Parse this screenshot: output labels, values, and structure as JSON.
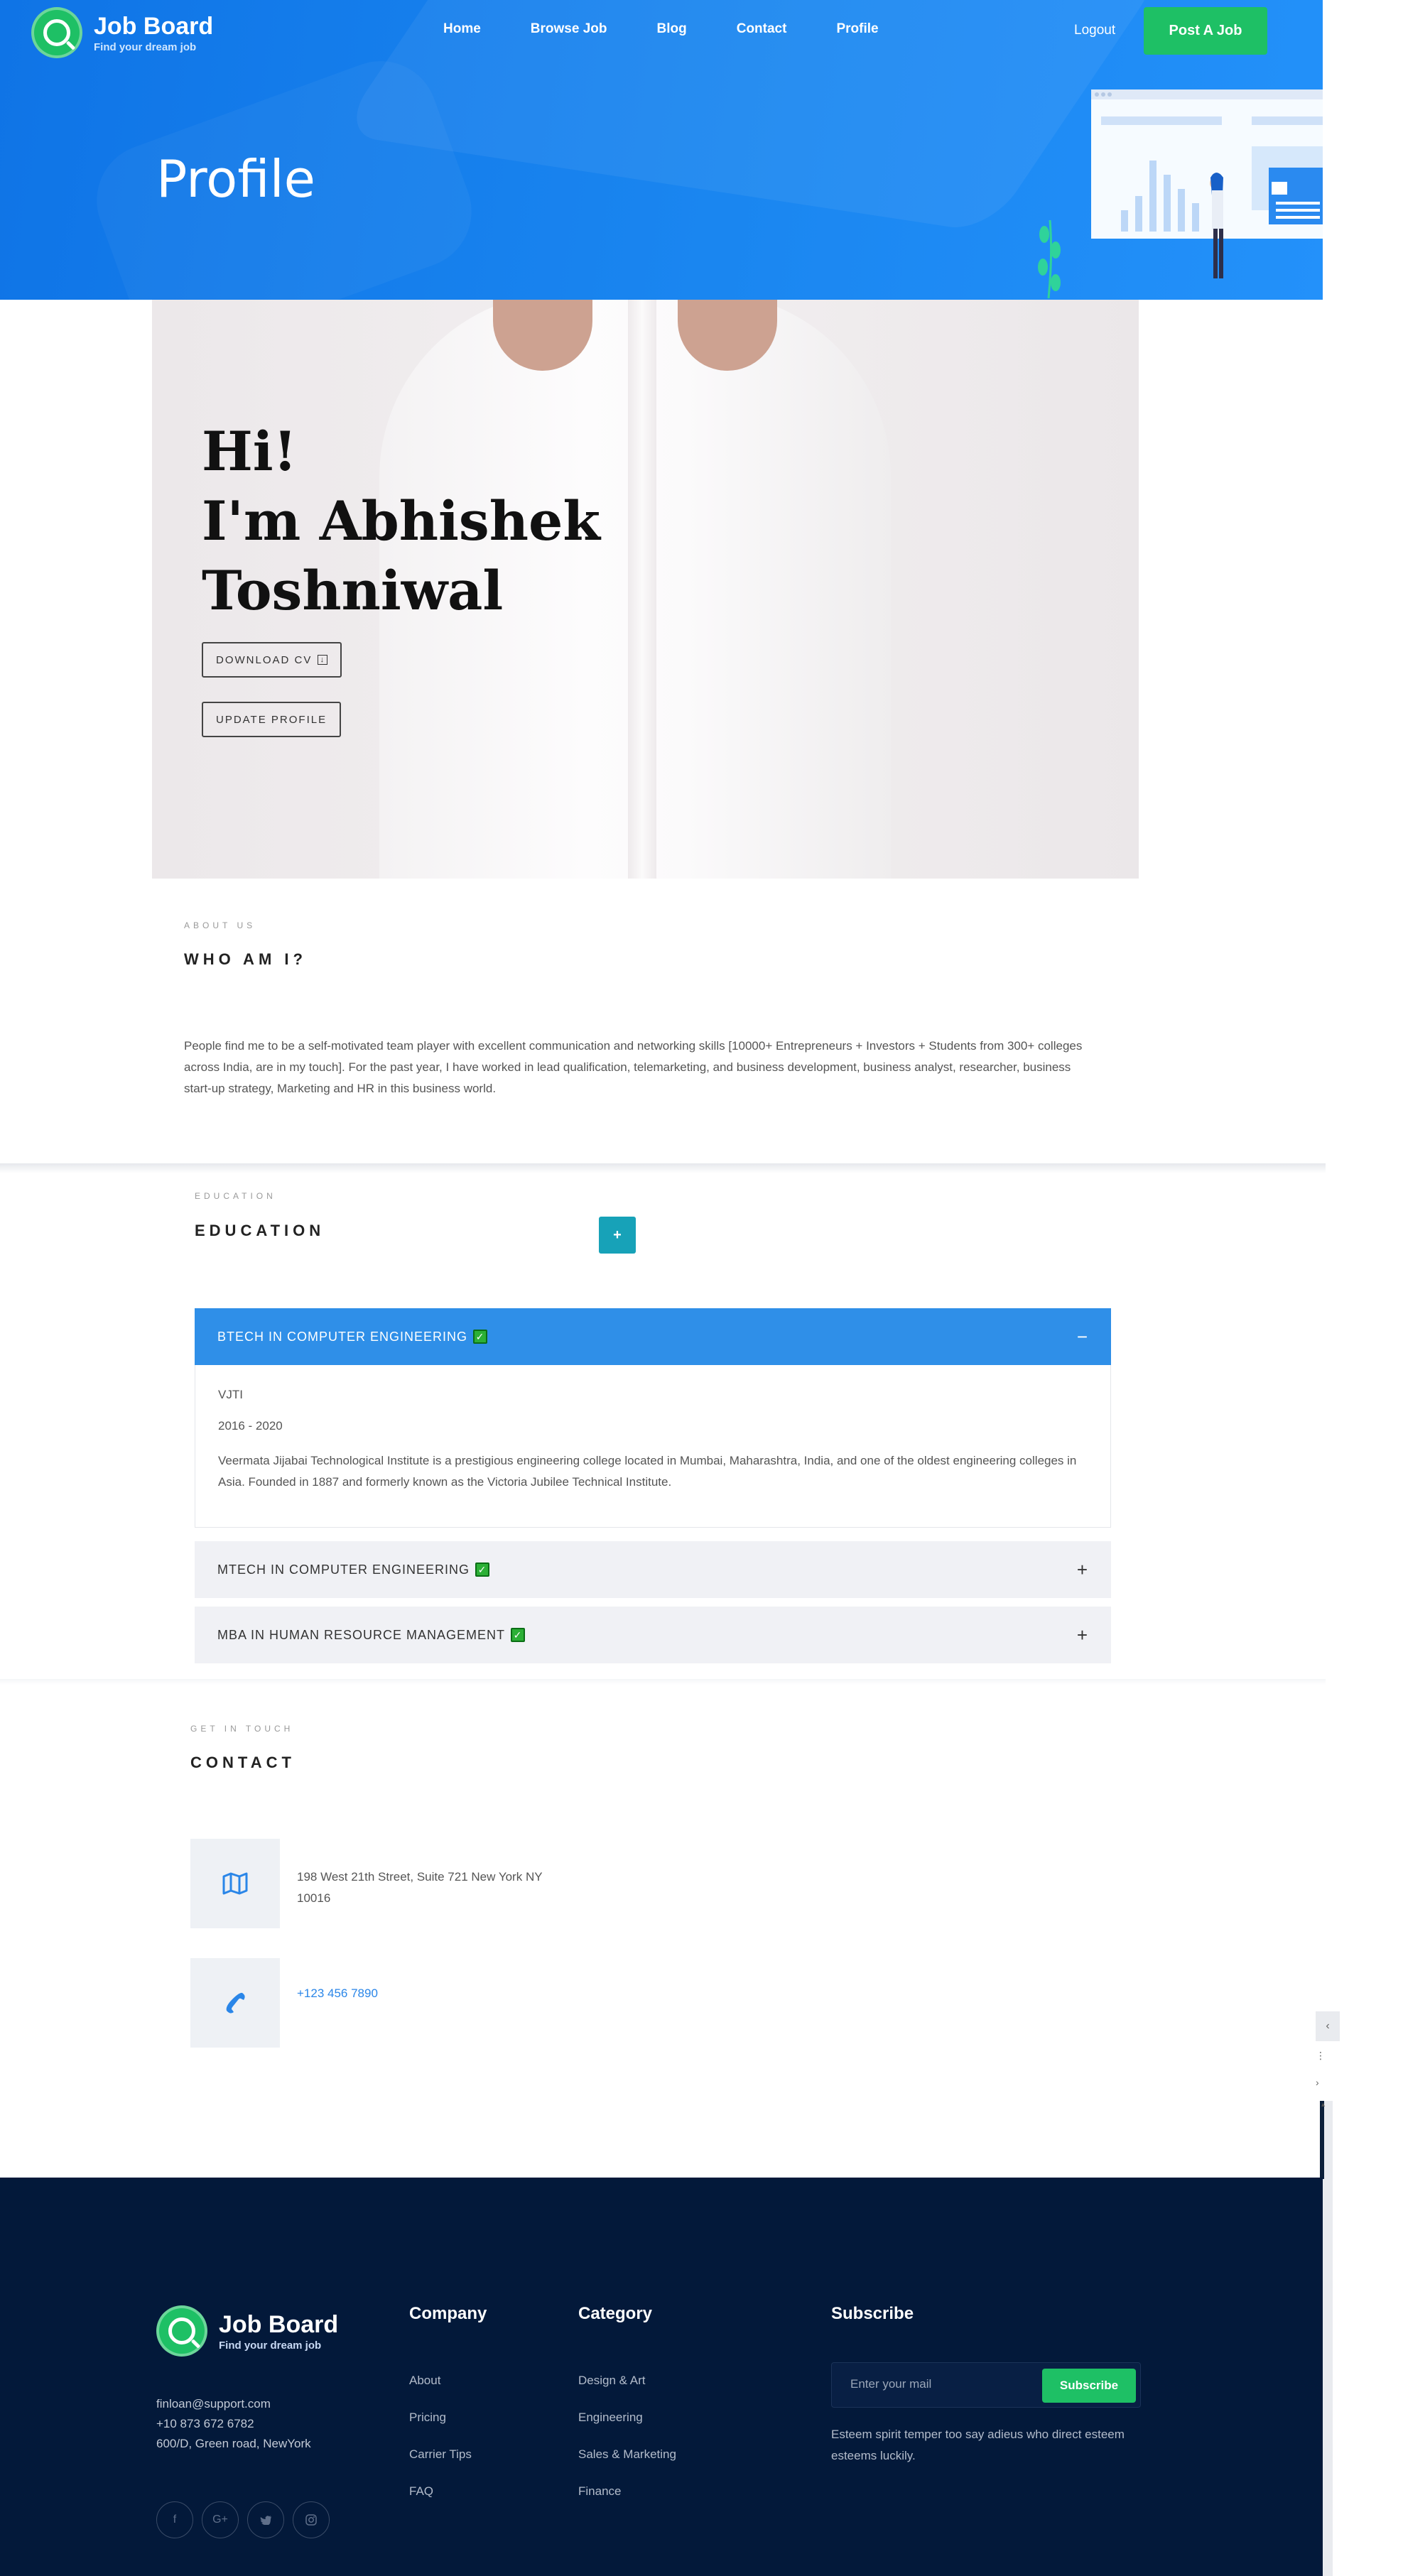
{
  "header": {
    "logo_title": "Job Board",
    "logo_subtitle": "Find your dream job",
    "nav": [
      "Home",
      "Browse Job",
      "Blog",
      "Contact",
      "Profile"
    ],
    "logout": "Logout",
    "post_job": "Post A Job",
    "page_title": "Profile"
  },
  "banner": {
    "greeting_line1": "Hi!",
    "greeting_line2": "I'm Abhishek",
    "greeting_line3": "Toshniwal",
    "download_cv": "DOWNLOAD CV",
    "update_profile": "UPDATE PROFILE"
  },
  "about": {
    "kicker": "ABOUT US",
    "heading": "WHO AM I?",
    "text": "People find me to be a self-motivated team player with excellent communication and networking skills [10000+ Entrepreneurs + Investors + Students from 300+ colleges across India, are in my touch]. For the past year, I have worked in lead qualification, telemarketing, and business development, business analyst, researcher, business start-up strategy, Marketing and HR in this business world."
  },
  "education": {
    "kicker": "EDUCATION",
    "heading": "EDUCATION",
    "add_label": "+",
    "items": [
      {
        "title": "BTECH IN COMPUTER ENGINEERING",
        "institute": "VJTI",
        "years": "2016 - 2020",
        "description": "Veermata Jijabai Technological Institute is a prestigious engineering college located in Mumbai, Maharashtra, India, and one of the oldest engineering colleges in Asia. Founded in 1887 and formerly known as the Victoria Jubilee Technical Institute.",
        "toggle": "−"
      },
      {
        "title": "MTECH IN COMPUTER ENGINEERING",
        "toggle": "+"
      },
      {
        "title": "MBA IN HUMAN RESOURCE MANAGEMENT",
        "toggle": "+"
      }
    ]
  },
  "contact": {
    "kicker": "GET IN TOUCH",
    "heading": "CONTACT",
    "address_line1": "198 West 21th Street, Suite 721 New York NY",
    "address_line2": "10016",
    "phone": "+123 456 7890"
  },
  "footer": {
    "logo_title": "Job Board",
    "logo_subtitle": "Find your dream job",
    "email": "finloan@support.com",
    "phone": "+10 873 672 6782",
    "address": "600/D, Green road, NewYork",
    "company_title": "Company",
    "company_links": [
      "About",
      "Pricing",
      "Carrier Tips",
      "FAQ"
    ],
    "category_title": "Category",
    "category_links": [
      "Design & Art",
      "Engineering",
      "Sales & Marketing",
      "Finance"
    ],
    "subscribe_title": "Subscribe",
    "subscribe_placeholder": "Enter your mail",
    "subscribe_button": "Subscribe",
    "subscribe_text": "Esteem spirit temper too say adieus who direct esteem esteems luckily.",
    "social_icons": [
      "facebook-icon",
      "google-plus-icon",
      "twitter-icon",
      "instagram-icon"
    ]
  },
  "colors": {
    "brand_blue": "#1a86f0",
    "brand_green": "#1ec065",
    "accordion_active": "#2f8fe8",
    "add_button": "#17a2b8",
    "footer_bg": "#03193a"
  }
}
